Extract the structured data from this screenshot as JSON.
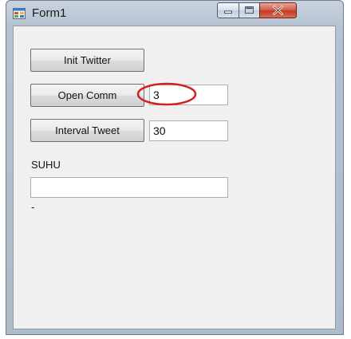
{
  "window": {
    "title": "Form1",
    "icon": "winforms-app-icon",
    "controls": {
      "minimize": "minimize-icon",
      "maximize": "maximize-icon",
      "close": "close-icon"
    }
  },
  "form": {
    "init_twitter_label": "Init Twitter",
    "open_comm_label": "Open Comm",
    "open_comm_value": "3",
    "interval_tweet_label": "Interval Tweet",
    "interval_tweet_value": "30",
    "suhu_label": "SUHU",
    "suhu_value": "",
    "status_text": "-"
  },
  "annotation": {
    "color": "#d32020"
  }
}
